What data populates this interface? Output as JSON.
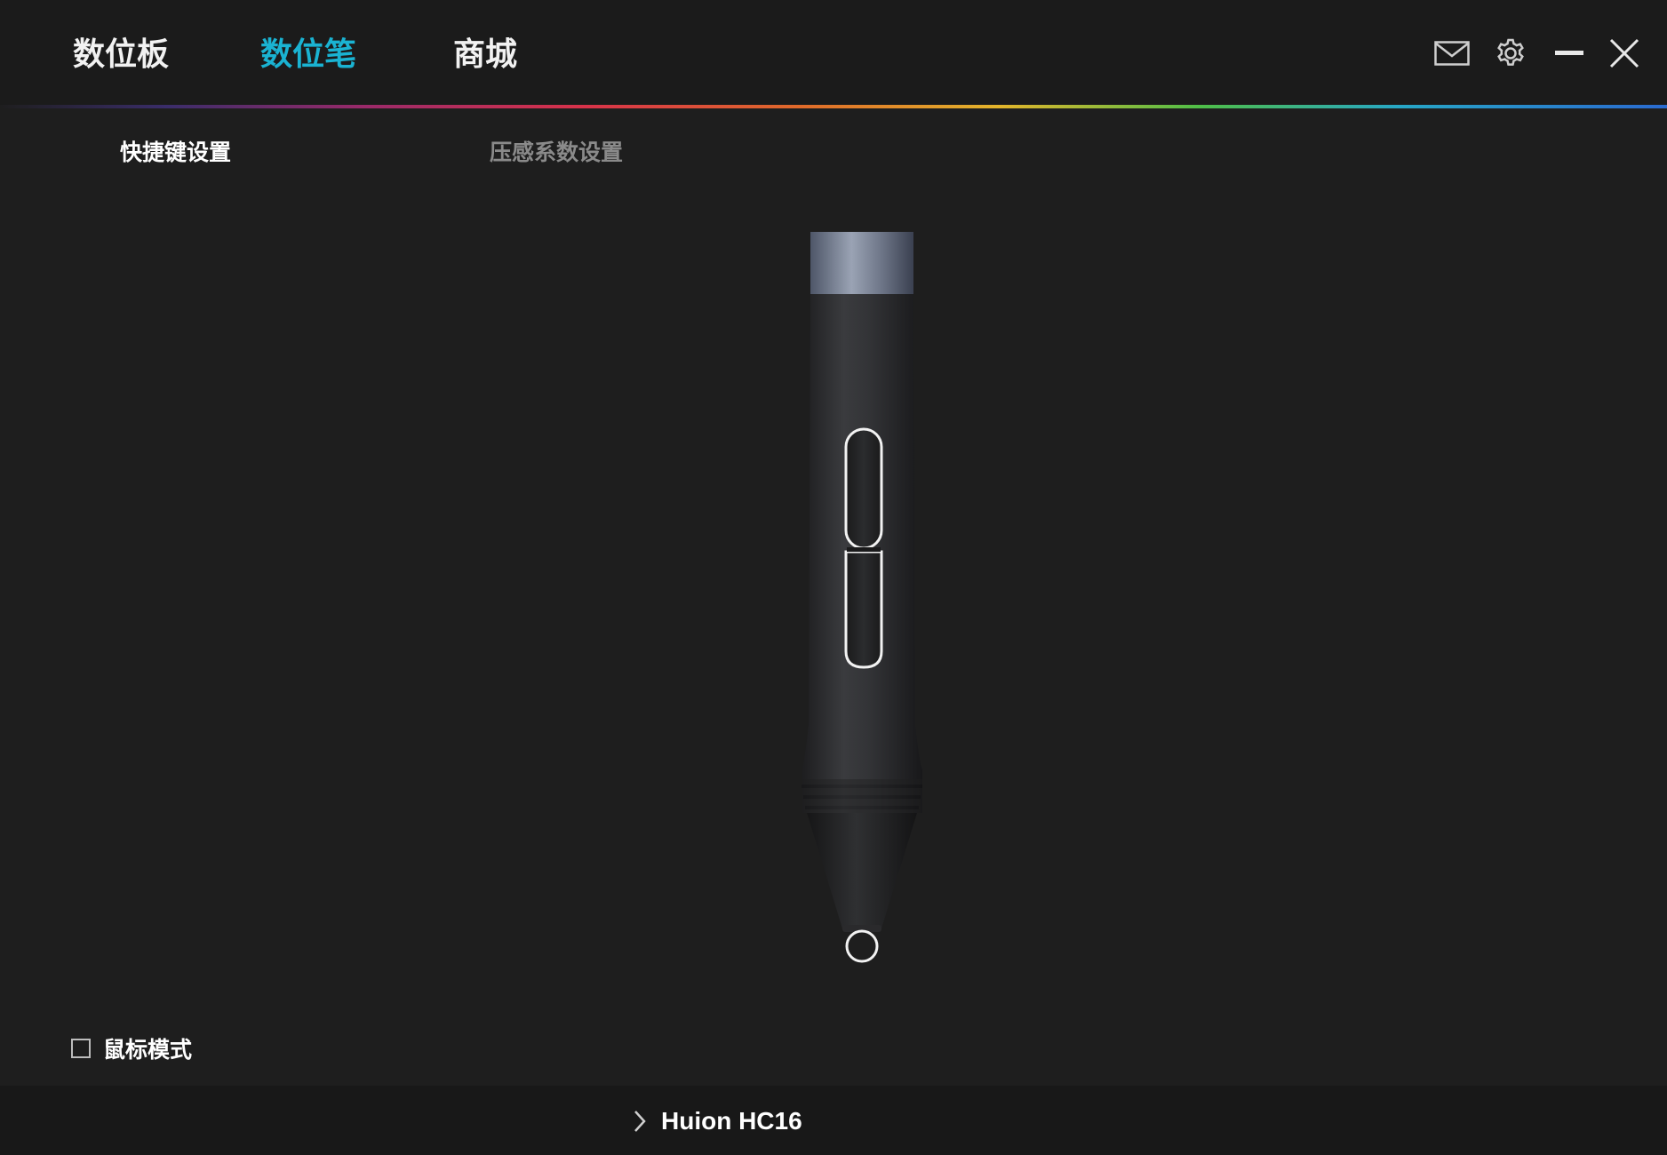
{
  "header": {
    "tabs": [
      {
        "label": "数位板"
      },
      {
        "label": "数位笔"
      },
      {
        "label": "商城"
      }
    ],
    "active_tab": "数位笔",
    "controls": [
      "mail-icon",
      "gear-icon",
      "minimize-icon",
      "close-icon"
    ]
  },
  "subtabs": [
    {
      "label": "快捷键设置"
    },
    {
      "label": "压感系数设置"
    }
  ],
  "active_subtab": "快捷键设置",
  "mouse_mode": {
    "label": "鼠标模式",
    "checked": false
  },
  "footer": {
    "device_name": "Huion HC16"
  },
  "colors": {
    "accent": "#1ab3d2",
    "background": "#1e1e1e",
    "inactive_text": "#8a8a8a"
  }
}
